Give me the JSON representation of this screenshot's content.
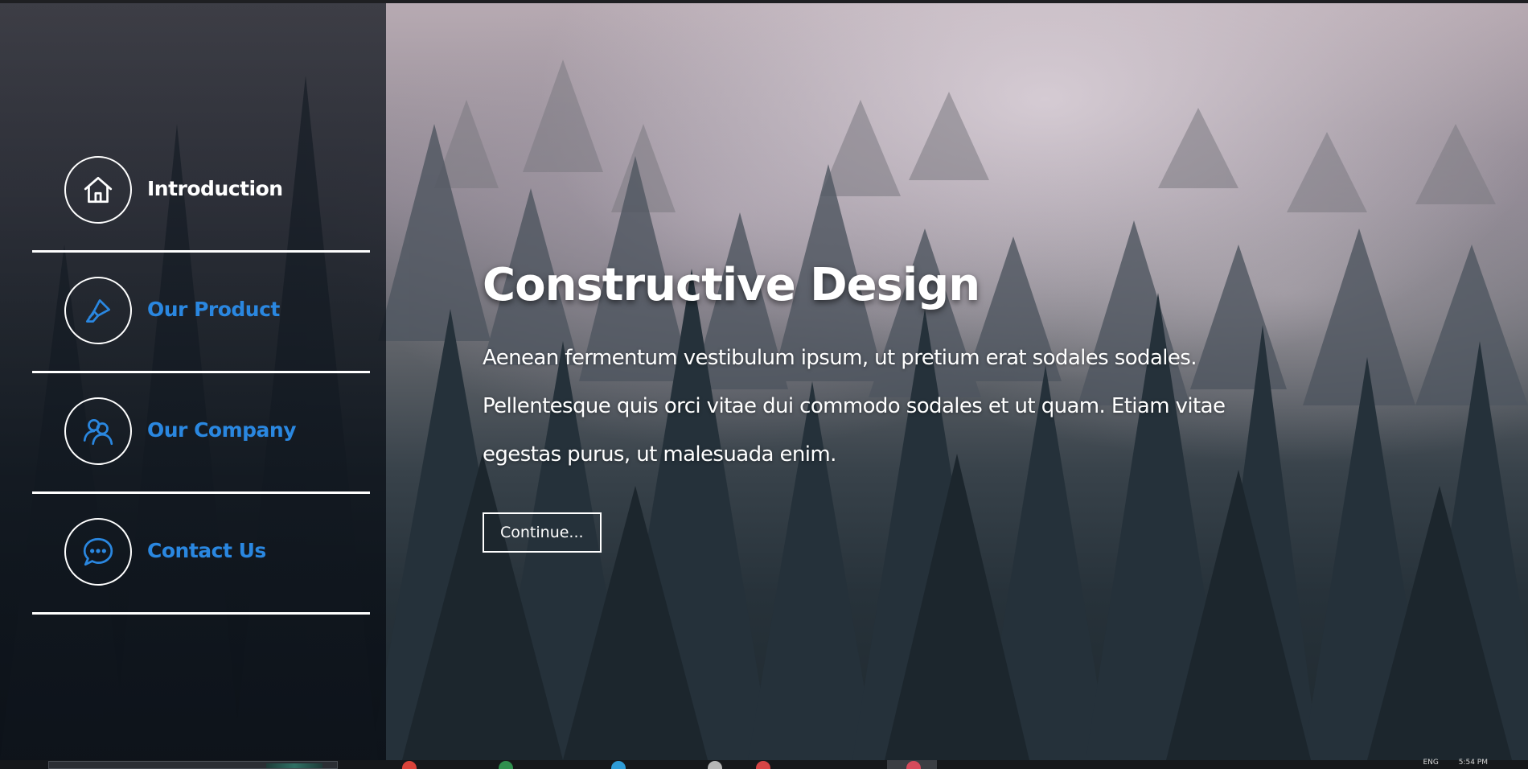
{
  "sidebar": {
    "items": [
      {
        "label": "Introduction",
        "icon": "home-icon",
        "state": "active"
      },
      {
        "label": "Our Product",
        "icon": "brush-icon",
        "state": "link"
      },
      {
        "label": "Our Company",
        "icon": "people-icon",
        "state": "link"
      },
      {
        "label": "Contact Us",
        "icon": "chat-bubble-icon",
        "state": "link"
      }
    ]
  },
  "hero": {
    "title": "Constructive Design",
    "text": "Aenean fermentum vestibulum ipsum, ut pretium erat sodales sodales. Pellentesque quis orci vitae dui commodo sodales et ut quam. Etiam vitae egestas purus, ut malesuada enim.",
    "button_label": "Continue..."
  },
  "taskbar": {
    "language": "ENG",
    "time": "5:54 PM"
  },
  "colors": {
    "accent": "#2a87e0",
    "text": "#ffffff",
    "sidebar_bg": "#0e141c"
  }
}
